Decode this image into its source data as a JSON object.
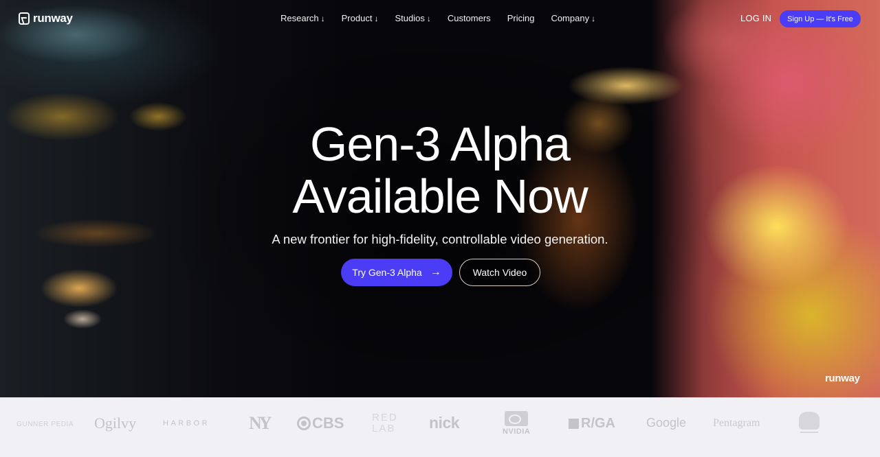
{
  "nav": {
    "brand": "runway",
    "links": [
      {
        "label": "Research",
        "has_dropdown": true
      },
      {
        "label": "Product",
        "has_dropdown": true
      },
      {
        "label": "Studios",
        "has_dropdown": true
      },
      {
        "label": "Customers",
        "has_dropdown": false
      },
      {
        "label": "Pricing",
        "has_dropdown": false
      },
      {
        "label": "Company",
        "has_dropdown": true
      }
    ],
    "dropdown_glyph": "↓",
    "login_label": "LOG IN",
    "signup_label": "Sign Up — It's Free"
  },
  "hero": {
    "headline_line1": "Gen-3 Alpha",
    "headline_line2": "Available Now",
    "subheadline": "A new frontier for high-fidelity, controllable video generation.",
    "primary_cta": "Try Gen-3 Alpha",
    "primary_cta_icon": "→",
    "secondary_cta": "Watch Video",
    "watermark": "runway"
  },
  "clients": {
    "logos": [
      "GUNNER PEDIA",
      "Ogilvy",
      "HARBOR",
      "NY",
      "CBS",
      "RED LAB",
      "nick",
      "NVIDIA",
      "R/GA",
      "Google",
      "Pentagram",
      "crest"
    ],
    "redlab_line1": "RED",
    "redlab_line2": "LAB"
  },
  "colors": {
    "accent": "#4b3cf5",
    "logo_strip_bg": "#f1f1f5",
    "logo_gray": "#c4c4c7"
  }
}
